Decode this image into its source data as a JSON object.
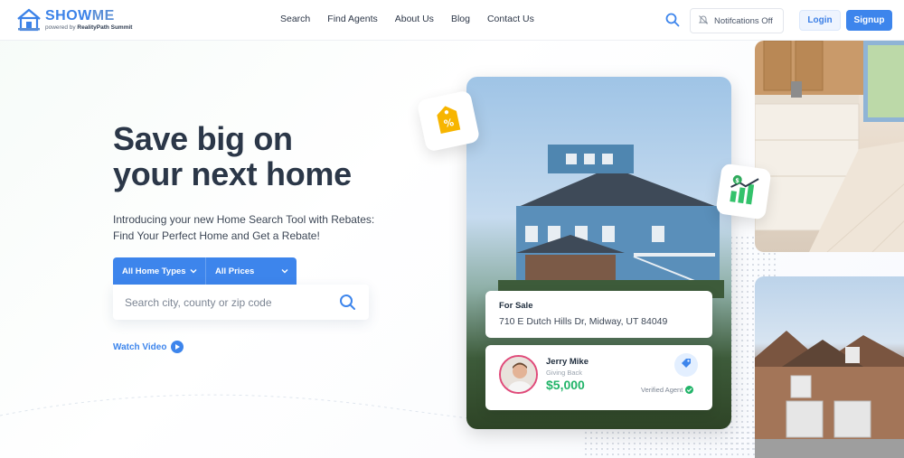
{
  "brand": {
    "name_show": "SHOW",
    "name_me": "ME",
    "tagline_prefix": "powered by ",
    "tagline_brand": "RealityPath Summit",
    "primary_color": "#3d85ec",
    "green_color": "#22b469"
  },
  "nav": {
    "links": [
      "Search",
      "Find Agents",
      "About Us",
      "Blog",
      "Contact Us"
    ],
    "notifications_label": "Notifcations Off",
    "login_label": "Login",
    "signup_label": "Signup"
  },
  "hero": {
    "title_line1": "Save big on",
    "title_line2": "your next home",
    "desc_line1": "Introducing your new Home Search Tool with Rebates:",
    "desc_line2": "Find Your Perfect Home and Get a Rebate!",
    "filter_home_types": "All Home Types",
    "filter_prices": "All Prices",
    "search_placeholder": "Search city, county or zip code",
    "watch_video": "Watch Video"
  },
  "listing": {
    "status": "For Sale",
    "address": "710 E Dutch Hills Dr, Midway, UT 84049"
  },
  "agent": {
    "name": "Jerry Mike",
    "subtitle": "Giving Back",
    "amount": "$5,000",
    "verified_label": "Verified Agent"
  },
  "icons": {
    "logo": "house-icon",
    "search": "search-icon",
    "notifications": "bell-off-icon",
    "chevron": "chevron-down-icon",
    "play": "play-icon",
    "tag": "discount-tag-icon",
    "chart": "money-growth-chart-icon",
    "check": "check-icon"
  }
}
